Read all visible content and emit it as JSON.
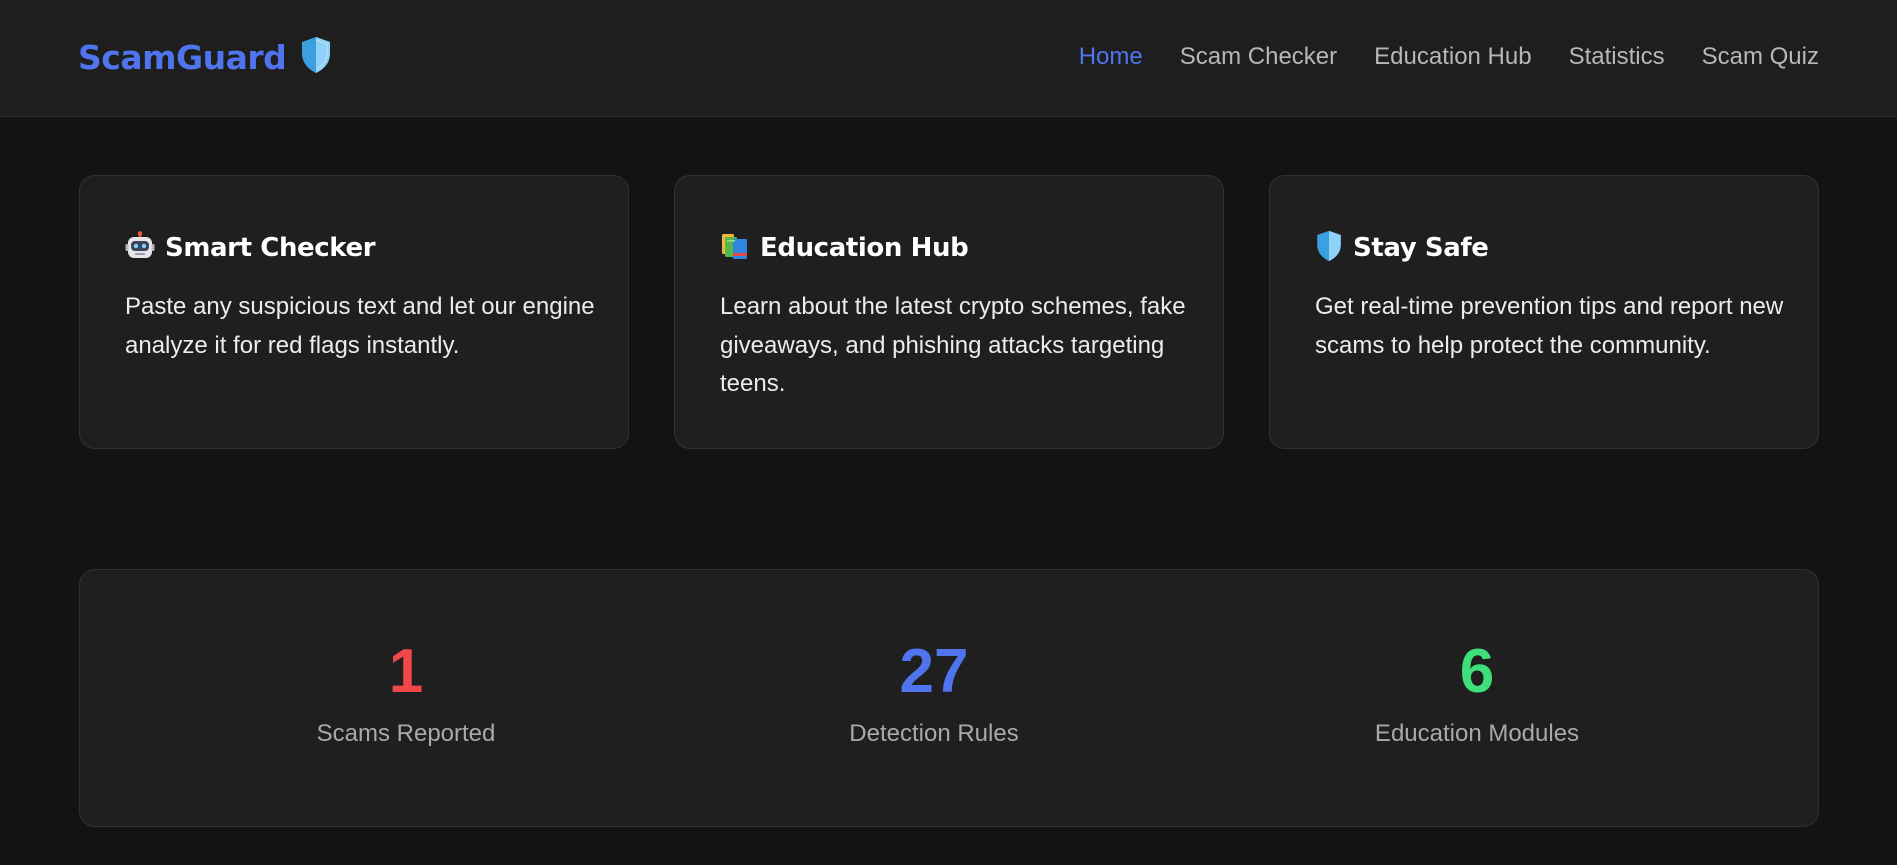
{
  "brand": {
    "name": "ScamGuard",
    "color": "#4f74ee",
    "icon": "shield-icon"
  },
  "nav": {
    "items": [
      {
        "label": "Home",
        "active": true
      },
      {
        "label": "Scam Checker",
        "active": false
      },
      {
        "label": "Education Hub",
        "active": false
      },
      {
        "label": "Statistics",
        "active": false
      },
      {
        "label": "Scam Quiz",
        "active": false
      }
    ]
  },
  "features": [
    {
      "icon": "robot-icon",
      "title": "Smart Checker",
      "text": "Paste any suspicious text and let our engine analyze it for red flags instantly."
    },
    {
      "icon": "books-icon",
      "title": "Education Hub",
      "text": "Learn about the latest crypto schemes, fake giveaways, and phishing attacks targeting teens."
    },
    {
      "icon": "shield-icon",
      "title": "Stay Safe",
      "text": "Get real-time prevention tips and report new scams to help protect the community."
    }
  ],
  "stats": [
    {
      "value": "1",
      "label": "Scams Reported",
      "color": "#f04848"
    },
    {
      "value": "27",
      "label": "Detection Rules",
      "color": "#4f74ee"
    },
    {
      "value": "6",
      "label": "Education Modules",
      "color": "#3fe07a"
    }
  ]
}
